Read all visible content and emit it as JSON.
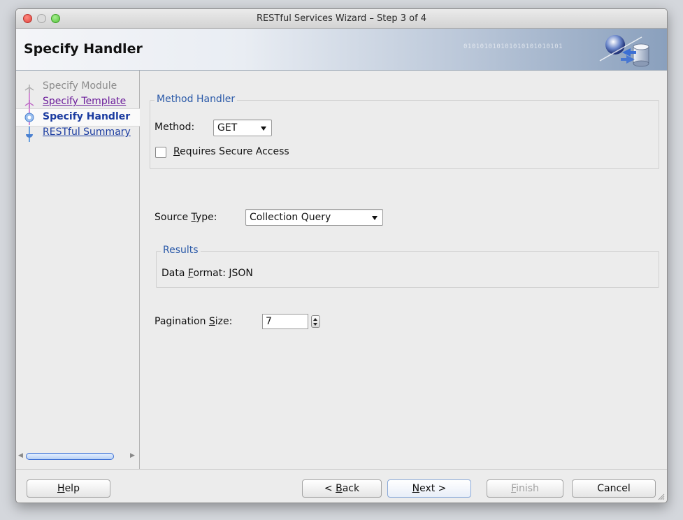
{
  "window": {
    "title": "RESTful Services Wizard – Step 3 of 4"
  },
  "header": {
    "title": "Specify  Handler",
    "binary_decoration": "010101010101010101010101"
  },
  "steps": [
    {
      "label": "Specify Module",
      "state": "done"
    },
    {
      "label": "Specify Template",
      "state": "visited"
    },
    {
      "label": "Specify  Handler",
      "state": "current"
    },
    {
      "label": "RESTful Summary",
      "state": "future"
    }
  ],
  "method_group": {
    "legend": "Method Handler",
    "method_label": "Method:",
    "method_value": "GET",
    "secure_label_mnemonic": "R",
    "secure_label_rest": "equires Secure Access",
    "secure_checked": false
  },
  "source": {
    "label_before": "Source ",
    "label_mnemonic": "T",
    "label_after": "ype:",
    "value": "Collection Query"
  },
  "results_group": {
    "legend": "Results",
    "format_before": "Data ",
    "format_mnemonic": "F",
    "format_after": "ormat: JSON"
  },
  "pagination": {
    "label_before": "Pagination ",
    "label_mnemonic": "S",
    "label_after": "ize:",
    "value": "7"
  },
  "buttons": {
    "help": {
      "mnemonic": "H",
      "rest": "elp"
    },
    "back": {
      "before": "< ",
      "mnemonic": "B",
      "rest": "ack"
    },
    "next": {
      "mnemonic": "N",
      "rest": "ext >"
    },
    "finish": {
      "mnemonic": "F",
      "rest": "inish"
    },
    "cancel": "Cancel"
  },
  "colors": {
    "link_visited": "#6a1a9a",
    "link": "#1a3ba0",
    "legend": "#2a59a8"
  }
}
